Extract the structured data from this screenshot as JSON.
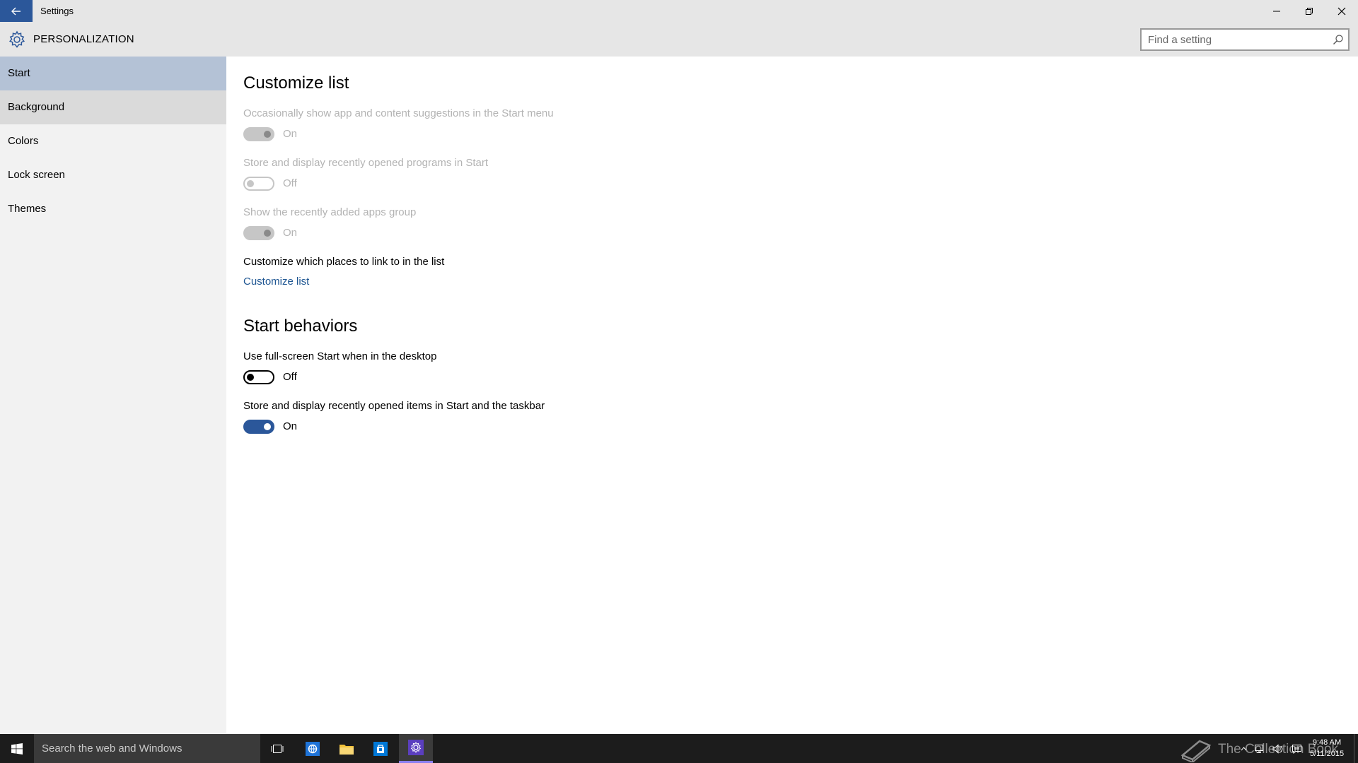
{
  "window": {
    "title": "Settings",
    "back_icon": "back-arrow-icon",
    "controls": {
      "minimize": "minimize-icon",
      "restore": "restore-icon",
      "close": "close-icon"
    }
  },
  "header": {
    "icon": "gear-icon",
    "title": "PERSONALIZATION",
    "search_placeholder": "Find a setting"
  },
  "sidebar": {
    "items": [
      {
        "label": "Start",
        "state": "selected"
      },
      {
        "label": "Background",
        "state": "hover"
      },
      {
        "label": "Colors",
        "state": "normal"
      },
      {
        "label": "Lock screen",
        "state": "normal"
      },
      {
        "label": "Themes",
        "state": "normal"
      }
    ]
  },
  "content": {
    "section1": {
      "heading": "Customize list",
      "settings": [
        {
          "label": "Occasionally show app and content suggestions in the Start menu",
          "state": "On",
          "enabled": false
        },
        {
          "label": "Store and display recently opened programs in Start",
          "state": "Off",
          "enabled": false
        },
        {
          "label": "Show the recently added apps group",
          "state": "On",
          "enabled": false
        }
      ],
      "places_label": "Customize which places to link to in the list",
      "places_link": "Customize list"
    },
    "section2": {
      "heading": "Start behaviors",
      "settings": [
        {
          "label": "Use full-screen Start when in the desktop",
          "state": "Off",
          "enabled": true
        },
        {
          "label": "Store and display recently opened items in Start and the taskbar",
          "state": "On",
          "enabled": true
        }
      ]
    }
  },
  "taskbar": {
    "search_text": "Search the web and Windows",
    "icons": [
      "windows-start-icon",
      "task-view-icon",
      "edge-browser-icon",
      "file-explorer-icon",
      "store-icon",
      "settings-app-icon"
    ],
    "watermark": "The Collection Book",
    "clock": {
      "time": "9:48 AM",
      "date": "5/11/2015"
    }
  },
  "colors": {
    "accent": "#2b579a",
    "selected_nav": "#b4c2d6",
    "link": "#1f5692",
    "chrome": "#e6e6e6",
    "taskbar": "#1c1c1c"
  }
}
